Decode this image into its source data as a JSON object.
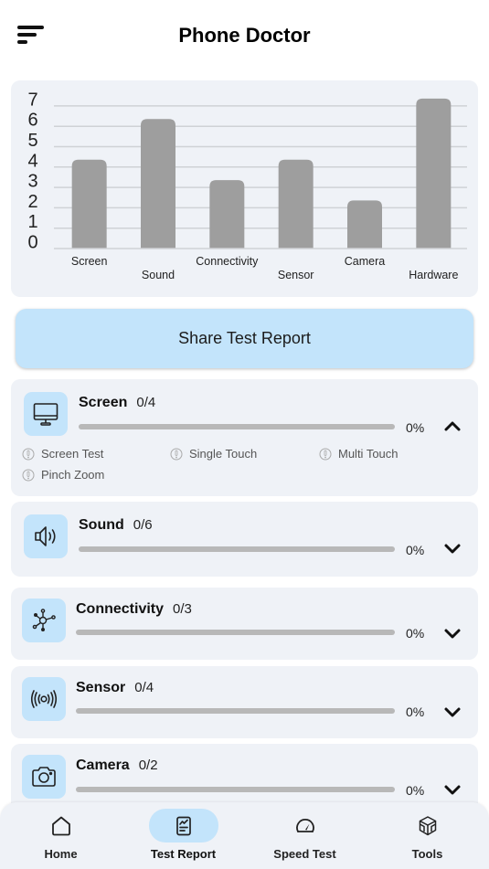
{
  "app_bar": {
    "title": "Phone Doctor",
    "menu_icon": "sort-menu-icon"
  },
  "chart_data": {
    "type": "bar",
    "title": "",
    "xlabel": "",
    "ylabel": "",
    "categories": [
      "Screen",
      "Sound",
      "Connectivity",
      "Sensor",
      "Camera",
      "Hardware"
    ],
    "values": [
      4,
      6,
      3,
      4,
      2,
      7
    ],
    "yticks": [
      "0",
      "1",
      "2",
      "3",
      "4",
      "5",
      "6",
      "7"
    ],
    "ylim": [
      0,
      7
    ],
    "grid": true,
    "legend": "none",
    "bar_color": "#9e9e9e",
    "grid_color": "#cfd2d6"
  },
  "share_button": {
    "label": "Share Test Report"
  },
  "test_cards": [
    {
      "title": "Screen",
      "count": "0/4",
      "progress": 0,
      "percent_label": "0%",
      "expanded": true,
      "icon": "monitor-icon",
      "subtests": [
        {
          "label": "Screen Test",
          "status_icon": "pending-info-icon"
        },
        {
          "label": "Single Touch",
          "status_icon": "pending-info-icon"
        },
        {
          "label": "Multi Touch",
          "status_icon": "pending-info-icon"
        },
        {
          "label": "Pinch Zoom",
          "status_icon": "pending-info-icon"
        }
      ]
    },
    {
      "title": "Sound",
      "count": "0/6",
      "progress": 0,
      "percent_label": "0%",
      "expanded": false,
      "icon": "speaker-icon"
    },
    {
      "title": "Connectivity",
      "count": "0/3",
      "progress": 0,
      "percent_label": "0%",
      "expanded": false,
      "icon": "network-hub-icon"
    },
    {
      "title": "Sensor",
      "count": "0/4",
      "progress": 0,
      "percent_label": "0%",
      "expanded": false,
      "icon": "broadcast-sensor-icon"
    },
    {
      "title": "Camera",
      "count": "0/2",
      "progress": 0,
      "percent_label": "0%",
      "expanded": false,
      "icon": "camera-icon"
    }
  ],
  "bottom_nav": {
    "items": [
      {
        "label": "Home",
        "icon": "home-icon",
        "active": false
      },
      {
        "label": "Test Report",
        "icon": "report-icon",
        "active": true
      },
      {
        "label": "Speed Test",
        "icon": "speedometer-icon",
        "active": false
      },
      {
        "label": "Tools",
        "icon": "cube-icon",
        "active": false
      }
    ]
  },
  "colors": {
    "accent_light": "#c3e4fb",
    "card_bg": "#eff2f7",
    "progress_track": "#b8b8b8"
  }
}
